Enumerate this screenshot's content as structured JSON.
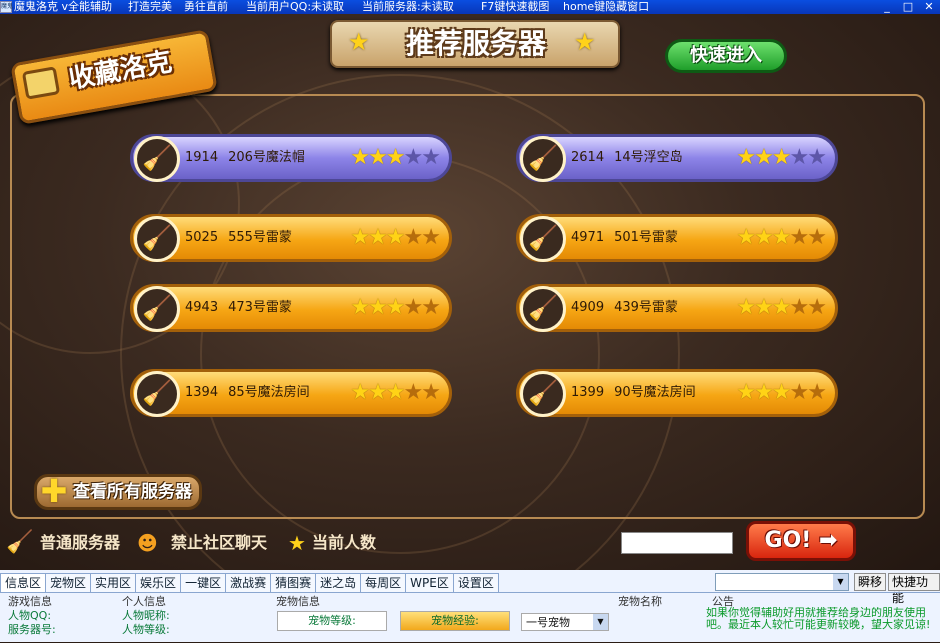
{
  "titlebar": {
    "icon_text": "魔鬼",
    "items": [
      "魔鬼洛克 v全能辅助",
      "打造完美",
      "勇往直前",
      "当前用户QQ:未读取",
      "当前服务器:未读取",
      "F7键快速截图",
      "home键隐藏窗口"
    ],
    "minimize": "_",
    "close": "□"
  },
  "game": {
    "header_title": "推荐服务器",
    "favorites_label": "收藏洛克",
    "quick_enter": "快速进入",
    "servers": [
      {
        "id": "1914",
        "name": "206号魔法帽",
        "rating": 3,
        "style": "purple"
      },
      {
        "id": "2614",
        "name": "14号浮空岛",
        "rating": 3,
        "style": "purple"
      },
      {
        "id": "5025",
        "name": "555号雷蒙",
        "rating": 3,
        "style": "orange"
      },
      {
        "id": "4971",
        "name": "501号雷蒙",
        "rating": 3,
        "style": "orange"
      },
      {
        "id": "4943",
        "name": "473号雷蒙",
        "rating": 3,
        "style": "orange"
      },
      {
        "id": "4909",
        "name": "439号雷蒙",
        "rating": 3,
        "style": "orange"
      },
      {
        "id": "1394",
        "name": "85号魔法房间",
        "rating": 3,
        "style": "orange"
      },
      {
        "id": "1399",
        "name": "90号魔法房间",
        "rating": 3,
        "style": "orange"
      }
    ],
    "view_all": "查看所有服务器",
    "legend": {
      "normal": "普通服务器",
      "no_chat": "禁止社区聊天",
      "current": "当前人数"
    },
    "go_label": "GO!",
    "go_input_value": ""
  },
  "panel": {
    "tabs": [
      "信息区",
      "宠物区",
      "实用区",
      "娱乐区",
      "一键区",
      "激战赛",
      "猜图赛",
      "迷之岛",
      "每周区",
      "WPE区",
      "设置区"
    ],
    "combo_value": "",
    "btn_instant": "瞬移",
    "btn_quick": "快捷功能",
    "game_info": {
      "title": "游戏信息",
      "qq": "人物QQ:",
      "server": "服务器号:"
    },
    "personal_info": {
      "title": "个人信息",
      "nickname": "人物昵称:",
      "level": "人物等级:"
    },
    "pet_info": {
      "title": "宠物信息",
      "pet_level": "宠物等级:",
      "pet_exp": "宠物经验:",
      "pet_select": "一号宠物"
    },
    "pet_name": "宠物名称",
    "announcement": {
      "title": "公告",
      "text": "如果你觉得辅助好用就推荐给身边的朋友使用吧。最近本人较忙可能更新较晚，望大家见谅!"
    }
  }
}
